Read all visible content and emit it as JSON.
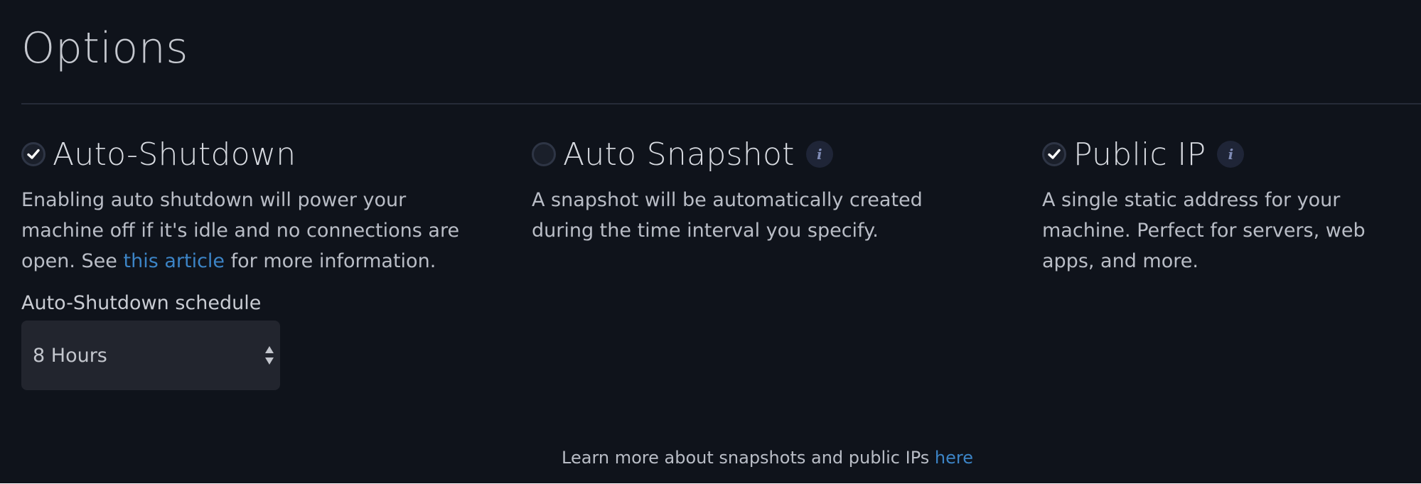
{
  "page": {
    "title": "Options"
  },
  "options": [
    {
      "title": "Auto-Shutdown",
      "checked": true,
      "desc_before": "Enabling auto shutdown will power your machine off if it's idle and no connections are open. See ",
      "link_text": "this article",
      "desc_after": " for more information.",
      "schedule": {
        "label": "Auto-Shutdown schedule",
        "selected": "8 Hours"
      }
    },
    {
      "title": "Auto Snapshot",
      "checked": false,
      "info_glyph": "i",
      "desc": "A snapshot will be automatically created during the time interval you specify."
    },
    {
      "title": "Public IP",
      "checked": true,
      "info_glyph": "i",
      "desc": "A single static address for your machine. Perfect for servers, web apps, and more."
    }
  ],
  "footer": {
    "text": "Learn more about snapshots and public IPs ",
    "link_text": "here"
  },
  "colors": {
    "background": "#0f131b",
    "link": "#3c84c6",
    "divider": "#252b38",
    "select_bg": "#22252e"
  },
  "icons": {
    "check": "checkmark-icon",
    "info": "info-icon",
    "select_arrows": "up-down-arrows-icon"
  }
}
